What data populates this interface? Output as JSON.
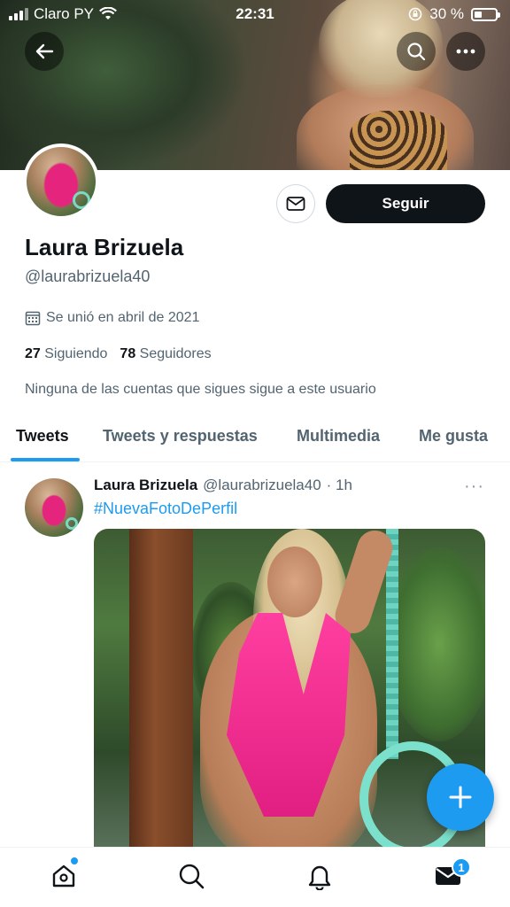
{
  "status_bar": {
    "carrier": "Claro PY",
    "time": "22:31",
    "battery": "30 %",
    "battery_level": 0.3
  },
  "header": {
    "back_icon": "arrow-left-icon",
    "search_icon": "search-icon",
    "more_icon": "more-icon"
  },
  "profile": {
    "name": "Laura Brizuela",
    "handle": "@laurabrizuela40",
    "joined": "Se unió en abril de 2021",
    "following_count": "27",
    "following_label": "Siguiendo",
    "followers_count": "78",
    "followers_label": "Seguidores",
    "follow_note": "Ninguna de las cuentas que sigues sigue a este usuario",
    "follow_button": "Seguir"
  },
  "tabs": [
    {
      "label": "Tweets",
      "active": true
    },
    {
      "label": "Tweets y respuestas",
      "active": false
    },
    {
      "label": "Multimedia",
      "active": false
    },
    {
      "label": "Me gusta",
      "active": false
    }
  ],
  "tweet": {
    "author": "Laura Brizuela",
    "handle": "@laurabrizuela40",
    "time": "· 1h",
    "text": "#NuevaFotoDePerfil",
    "more": "···"
  },
  "bottom_nav": {
    "items": [
      "home-icon",
      "search-icon",
      "bell-icon",
      "mail-icon"
    ],
    "mail_badge": "1"
  },
  "colors": {
    "accent": "#1d9bf0",
    "text": "#0f1419",
    "muted": "#536471"
  }
}
